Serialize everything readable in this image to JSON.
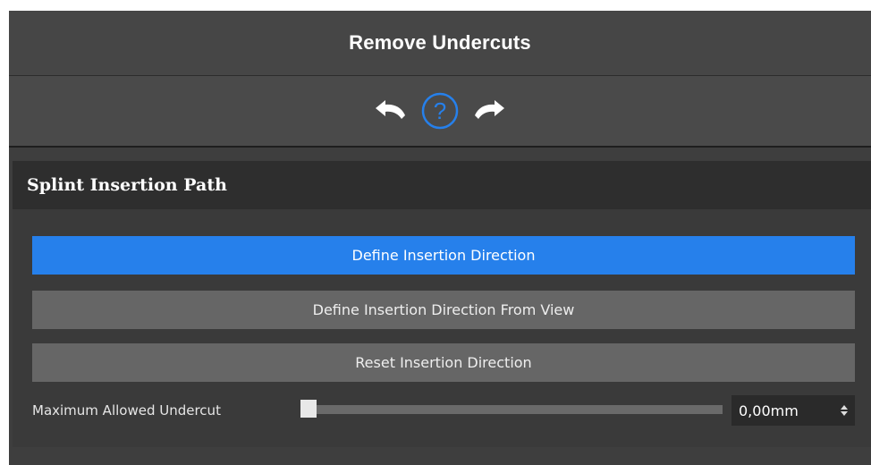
{
  "panel": {
    "title": "Remove Undercuts"
  },
  "toolbar": {
    "undo_icon": "undo-arrow-icon",
    "help_icon": "help-question-icon",
    "redo_icon": "redo-arrow-icon",
    "accent_color": "#2680eb"
  },
  "section": {
    "title": "Splint Insertion Path",
    "buttons": [
      {
        "label": "Define Insertion Direction",
        "active": true
      },
      {
        "label": "Define Insertion Direction From View",
        "active": false
      },
      {
        "label": "Reset Insertion Direction",
        "active": false
      }
    ],
    "slider": {
      "label": "Maximum Allowed Undercut",
      "value_fraction": 0,
      "value_text": "0,00mm"
    }
  }
}
